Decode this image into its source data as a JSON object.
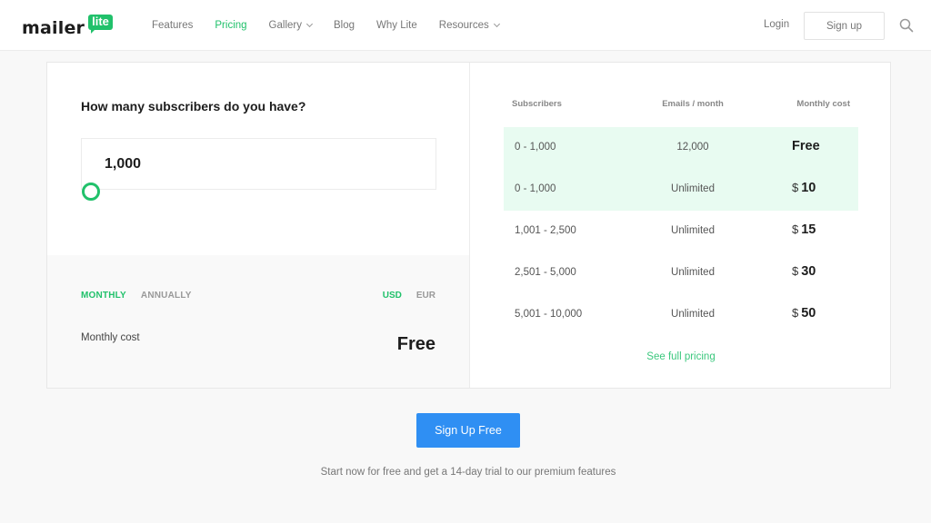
{
  "header": {
    "logo": {
      "word": "mailer",
      "badge": "lite"
    },
    "nav": [
      {
        "label": "Features",
        "active": false,
        "dropdown": false
      },
      {
        "label": "Pricing",
        "active": true,
        "dropdown": false
      },
      {
        "label": "Gallery",
        "active": false,
        "dropdown": true
      },
      {
        "label": "Blog",
        "active": false,
        "dropdown": false
      },
      {
        "label": "Why Lite",
        "active": false,
        "dropdown": false
      },
      {
        "label": "Resources",
        "active": false,
        "dropdown": true
      }
    ],
    "login_label": "Login",
    "signup_label": "Sign up",
    "search_icon": "search-icon"
  },
  "calculator": {
    "question": "How many subscribers do you have?",
    "subscribers_value": "1,000",
    "slider_position": 0,
    "billing_period": {
      "options": [
        "MONTHLY",
        "ANNUALLY"
      ],
      "selected": "MONTHLY"
    },
    "currency": {
      "options": [
        "USD",
        "EUR"
      ],
      "selected": "USD"
    },
    "cost_label": "Monthly cost",
    "cost_value": "Free"
  },
  "pricing_table": {
    "headers": {
      "subscribers": "Subscribers",
      "emails": "Emails / month",
      "cost": "Monthly cost"
    },
    "rows": [
      {
        "subscribers": "0 - 1,000",
        "emails": "12,000",
        "currency": "",
        "cost": "Free",
        "highlighted": true
      },
      {
        "subscribers": "0 - 1,000",
        "emails": "Unlimited",
        "currency": "$",
        "cost": "10",
        "highlighted": true
      },
      {
        "subscribers": "1,001 - 2,500",
        "emails": "Unlimited",
        "currency": "$",
        "cost": "15",
        "highlighted": false
      },
      {
        "subscribers": "2,501 - 5,000",
        "emails": "Unlimited",
        "currency": "$",
        "cost": "30",
        "highlighted": false
      },
      {
        "subscribers": "5,001 - 10,000",
        "emails": "Unlimited",
        "currency": "$",
        "cost": "50",
        "highlighted": false
      }
    ],
    "see_full_label": "See full pricing"
  },
  "cta": {
    "button_label": "Sign Up Free",
    "tagline": "Start now for free and get a 14-day trial to our premium features"
  },
  "colors": {
    "brand_green": "#21c16b",
    "highlight_row": "#e8fbf1",
    "cta_blue": "#2f8ff3"
  }
}
